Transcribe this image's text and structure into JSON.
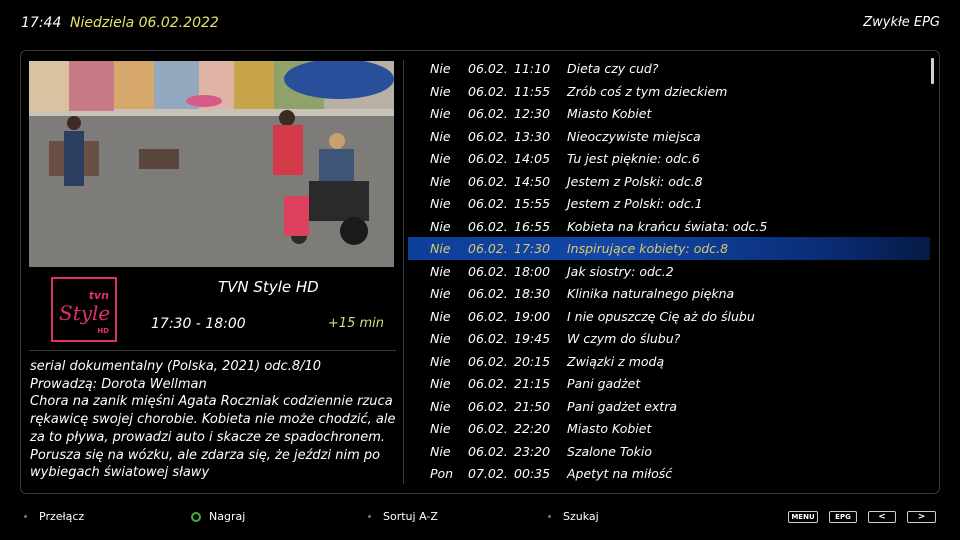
{
  "header": {
    "clock": "17:44",
    "date": "Niedziela 06.02.2022",
    "mode": "Zwykłe EPG"
  },
  "channel": {
    "logo_main": "Style",
    "logo_brand": "tvn",
    "logo_hd": "HD",
    "name": "TVN Style HD",
    "time_range": "17:30 - 18:00",
    "remaining": "+15 min"
  },
  "description": {
    "line1": "serial dokumentalny (Polska, 2021) odc.8/10",
    "line2": "Prowadzą: Dorota Wellman",
    "body": "Chora na zanik mięśni Agata Roczniak codziennie rzuca rękawicę swojej chorobie. Kobieta nie może chodzić, ale za to pływa, prowadzi auto i skacze ze spadochronem. Porusza się na wózku, ale zdarza się, że jeździ nim po wybiegach światowej sławy"
  },
  "epg": [
    {
      "day": "Nie",
      "date": "06.02.",
      "time": "11:10",
      "title": "Dieta czy cud?"
    },
    {
      "day": "Nie",
      "date": "06.02.",
      "time": "11:55",
      "title": "Zrób coś z tym dzieckiem"
    },
    {
      "day": "Nie",
      "date": "06.02.",
      "time": "12:30",
      "title": "Miasto Kobiet"
    },
    {
      "day": "Nie",
      "date": "06.02.",
      "time": "13:30",
      "title": "Nieoczywiste miejsca"
    },
    {
      "day": "Nie",
      "date": "06.02.",
      "time": "14:05",
      "title": "Tu jest pięknie: odc.6"
    },
    {
      "day": "Nie",
      "date": "06.02.",
      "time": "14:50",
      "title": "Jestem z Polski: odc.8"
    },
    {
      "day": "Nie",
      "date": "06.02.",
      "time": "15:55",
      "title": "Jestem z Polski: odc.1"
    },
    {
      "day": "Nie",
      "date": "06.02.",
      "time": "16:55",
      "title": "Kobieta na krańcu świata: odc.5"
    },
    {
      "day": "Nie",
      "date": "06.02.",
      "time": "17:30",
      "title": "Inspirujące kobiety: odc.8",
      "selected": true
    },
    {
      "day": "Nie",
      "date": "06.02.",
      "time": "18:00",
      "title": "Jak siostry: odc.2"
    },
    {
      "day": "Nie",
      "date": "06.02.",
      "time": "18:30",
      "title": "Klinika naturalnego piękna"
    },
    {
      "day": "Nie",
      "date": "06.02.",
      "time": "19:00",
      "title": "I nie opuszczę Cię aż do ślubu"
    },
    {
      "day": "Nie",
      "date": "06.02.",
      "time": "19:45",
      "title": "W czym do ślubu?"
    },
    {
      "day": "Nie",
      "date": "06.02.",
      "time": "20:15",
      "title": "Związki z modą"
    },
    {
      "day": "Nie",
      "date": "06.02.",
      "time": "21:15",
      "title": "Pani gadżet"
    },
    {
      "day": "Nie",
      "date": "06.02.",
      "time": "21:50",
      "title": "Pani gadżet extra"
    },
    {
      "day": "Nie",
      "date": "06.02.",
      "time": "22:20",
      "title": "Miasto Kobiet"
    },
    {
      "day": "Nie",
      "date": "06.02.",
      "time": "23:20",
      "title": "Szalone Tokio"
    },
    {
      "day": "Pon",
      "date": "07.02.",
      "time": "00:35",
      "title": "Apetyt na miłość"
    }
  ],
  "footer": {
    "switch_label": "Przełącz",
    "record_label": "Nagraj",
    "sort_label": "Sortuj A-Z",
    "search_label": "Szukaj",
    "menu_key": "MENU",
    "epg_key": "EPG",
    "prev_key": "<",
    "next_key": ">"
  },
  "colors": {
    "date_text": "#e8e26a",
    "remaining_text": "#c7e27a",
    "selected_row": "#1247a8",
    "selected_text": "#d9c96a",
    "logo_accent": "#e0306a",
    "record_ring": "#3fae3f"
  }
}
